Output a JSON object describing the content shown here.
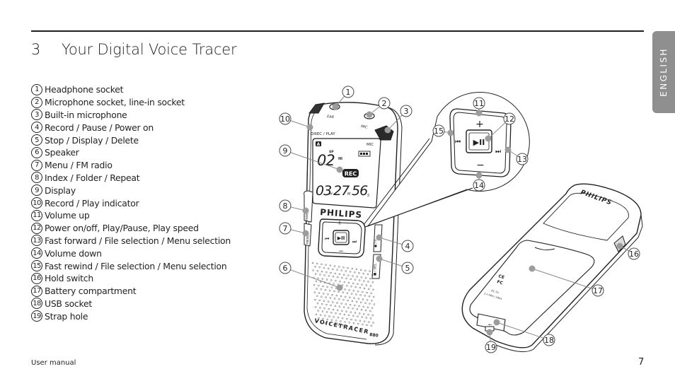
{
  "header": {
    "section_number": "3",
    "title": "Your Digital Voice Tracer",
    "language_tab": "ENGLISH"
  },
  "parts": [
    {
      "num": "1",
      "label": "Headphone socket"
    },
    {
      "num": "2",
      "label": "Microphone socket, line-in socket"
    },
    {
      "num": "3",
      "label": "Built-in microphone"
    },
    {
      "num": "4",
      "label": "Record / Pause / Power on"
    },
    {
      "num": "5",
      "label": "Stop / Display / Delete"
    },
    {
      "num": "6",
      "label": "Speaker"
    },
    {
      "num": "7",
      "label": "Menu / FM radio"
    },
    {
      "num": "8",
      "label": "Index / Folder / Repeat"
    },
    {
      "num": "9",
      "label": "Display"
    },
    {
      "num": "10",
      "label": "Record / Play indicator"
    },
    {
      "num": "11",
      "label": "Volume up"
    },
    {
      "num": "12",
      "label": "Power on/off, Play/Pause, Play speed"
    },
    {
      "num": "13",
      "label": "Fast forward / File selection / Menu selection"
    },
    {
      "num": "14",
      "label": "Volume down"
    },
    {
      "num": "15",
      "label": "Fast rewind / File selection / Menu selection"
    },
    {
      "num": "16",
      "label": "Hold switch"
    },
    {
      "num": "17",
      "label": "Battery compartment"
    },
    {
      "num": "18",
      "label": "USB socket"
    },
    {
      "num": "19",
      "label": "Strap hole"
    }
  ],
  "device": {
    "brand": "PHILIPS",
    "model": "VOICETRACER",
    "model_number": "880",
    "ear_label": "EAR",
    "mic_label": "MIC",
    "rec_play_label": "REC / PLAY",
    "screen": {
      "folder": "A",
      "mic": "MIC",
      "file_number": "02",
      "mode_sp": "SP",
      "quality_hi": "HI",
      "rec_badge": "REC",
      "time_h": "03",
      "time_m": "27",
      "time_s": "56",
      "unit_h": "H",
      "unit_m": "M",
      "unit_s": "S"
    },
    "side_left_1": "INDEX / ",
    "side_left_2": "MENU",
    "side_right_1": "● / II",
    "side_right_2": "■ / DEL",
    "keypad": {
      "plus": "+",
      "minus": "−",
      "rewind": "⏮",
      "forward": "⏭",
      "play_pause": "▶II"
    },
    "back": {
      "cert_1": "CE",
      "cert_2": "FC",
      "power_spec": "DC 3V",
      "battery_spec": "2 x AAA / LR03"
    }
  },
  "footer": {
    "doc_name": "User manual",
    "page_number": "7"
  }
}
